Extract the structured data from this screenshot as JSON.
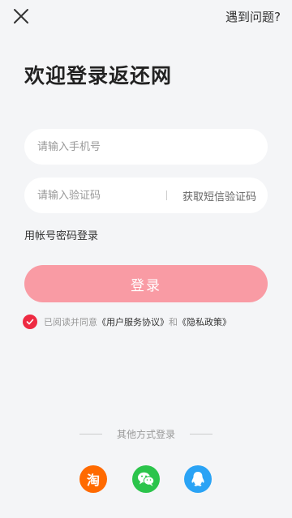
{
  "header": {
    "close_icon": "close-icon",
    "help_label": "遇到问题?"
  },
  "title": "欢迎登录返还网",
  "phone": {
    "placeholder": "请输入手机号",
    "value": ""
  },
  "code": {
    "placeholder": "请输入验证码",
    "value": "",
    "get_code_label": "获取短信验证码"
  },
  "password_login_label": "用帐号密码登录",
  "login_button_label": "登录",
  "agreement": {
    "checked": true,
    "prefix": "已阅读并同意",
    "user_agreement": "《用户服务协议》",
    "and": "和",
    "privacy_policy": "《隐私政策》"
  },
  "other_login": {
    "title": "其他方式登录",
    "providers": [
      {
        "name": "taobao",
        "glyph": "淘",
        "color": "#ff6a00"
      },
      {
        "name": "wechat",
        "icon": "wechat-icon",
        "color": "#2bc44b"
      },
      {
        "name": "qq",
        "icon": "qq-icon",
        "color": "#2aa3f5"
      }
    ]
  },
  "colors": {
    "accent": "#ee2a42",
    "login_button": "#f99ba4",
    "background": "#f4f5f7"
  }
}
